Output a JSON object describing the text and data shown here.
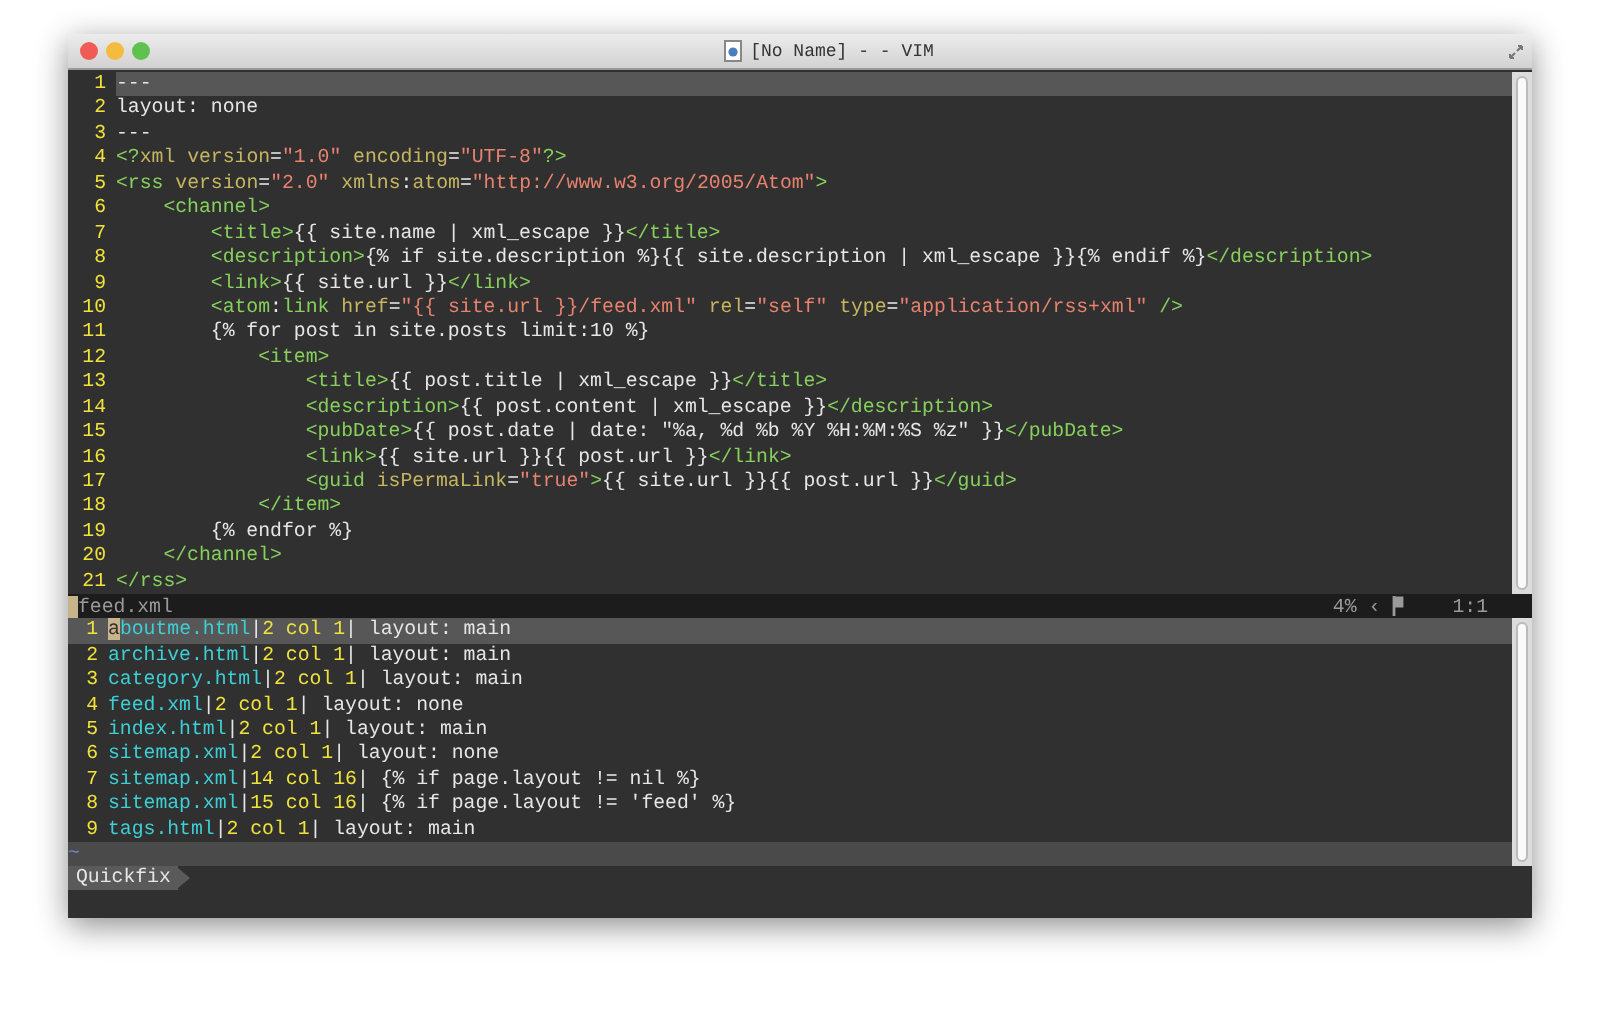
{
  "window": {
    "title": "[No Name] - - VIM"
  },
  "editor": {
    "lines": [
      {
        "number": "1",
        "current": true,
        "tokens": [
          {
            "kind": "text",
            "text": "---"
          }
        ]
      },
      {
        "number": "2",
        "current": false,
        "tokens": [
          {
            "kind": "text",
            "text": "layout: none"
          }
        ]
      },
      {
        "number": "3",
        "current": false,
        "tokens": [
          {
            "kind": "text",
            "text": "---"
          }
        ]
      },
      {
        "number": "4",
        "current": false,
        "tokens": [
          {
            "kind": "tag",
            "text": "<?"
          },
          {
            "kind": "attr",
            "text": "xml version"
          },
          {
            "kind": "text",
            "text": "="
          },
          {
            "kind": "string",
            "text": "\"1.0\""
          },
          {
            "kind": "attr",
            "text": " encoding"
          },
          {
            "kind": "text",
            "text": "="
          },
          {
            "kind": "string",
            "text": "\"UTF-8\""
          },
          {
            "kind": "tag",
            "text": "?>"
          }
        ]
      },
      {
        "number": "5",
        "current": false,
        "tokens": [
          {
            "kind": "tag",
            "text": "<rss"
          },
          {
            "kind": "attr",
            "text": " version"
          },
          {
            "kind": "text",
            "text": "="
          },
          {
            "kind": "string",
            "text": "\"2.0\""
          },
          {
            "kind": "attr",
            "text": " xmlns"
          },
          {
            "kind": "text",
            "text": ":"
          },
          {
            "kind": "attr",
            "text": "atom"
          },
          {
            "kind": "text",
            "text": "="
          },
          {
            "kind": "string",
            "text": "\"http://www.w3.org/2005/Atom\""
          },
          {
            "kind": "tag",
            "text": ">"
          }
        ]
      },
      {
        "number": "6",
        "current": false,
        "tokens": [
          {
            "kind": "tag",
            "text": "    <channel>"
          }
        ]
      },
      {
        "number": "7",
        "current": false,
        "tokens": [
          {
            "kind": "tag",
            "text": "        <title>"
          },
          {
            "kind": "text",
            "text": "{{ site.name | xml_escape }}"
          },
          {
            "kind": "tag",
            "text": "</title>"
          }
        ]
      },
      {
        "number": "8",
        "current": false,
        "tokens": [
          {
            "kind": "tag",
            "text": "        <description>"
          },
          {
            "kind": "text",
            "text": "{% if site.description %}{{ site.description | xml_escape }}{% endif %}"
          },
          {
            "kind": "tag",
            "text": "</description>"
          }
        ]
      },
      {
        "number": "9",
        "current": false,
        "tokens": [
          {
            "kind": "tag",
            "text": "        <link>"
          },
          {
            "kind": "text",
            "text": "{{ site.url }}"
          },
          {
            "kind": "tag",
            "text": "</link>"
          }
        ]
      },
      {
        "number": "10",
        "current": false,
        "tokens": [
          {
            "kind": "tag",
            "text": "        <atom"
          },
          {
            "kind": "text",
            "text": ":"
          },
          {
            "kind": "tag",
            "text": "link"
          },
          {
            "kind": "attr",
            "text": " href"
          },
          {
            "kind": "text",
            "text": "="
          },
          {
            "kind": "string",
            "text": "\"{{ site.url }}/feed.xml\""
          },
          {
            "kind": "attr",
            "text": " rel"
          },
          {
            "kind": "text",
            "text": "="
          },
          {
            "kind": "string",
            "text": "\"self\""
          },
          {
            "kind": "attr",
            "text": " type"
          },
          {
            "kind": "text",
            "text": "="
          },
          {
            "kind": "string",
            "text": "\"application/rss+xml\""
          },
          {
            "kind": "tag",
            "text": " />"
          }
        ]
      },
      {
        "number": "11",
        "current": false,
        "tokens": [
          {
            "kind": "text",
            "text": "        {% for post in site.posts limit:10 %}"
          }
        ]
      },
      {
        "number": "12",
        "current": false,
        "tokens": [
          {
            "kind": "tag",
            "text": "            <item>"
          }
        ]
      },
      {
        "number": "13",
        "current": false,
        "tokens": [
          {
            "kind": "tag",
            "text": "                <title>"
          },
          {
            "kind": "text",
            "text": "{{ post.title | xml_escape }}"
          },
          {
            "kind": "tag",
            "text": "</title>"
          }
        ]
      },
      {
        "number": "14",
        "current": false,
        "tokens": [
          {
            "kind": "tag",
            "text": "                <description>"
          },
          {
            "kind": "text",
            "text": "{{ post.content | xml_escape }}"
          },
          {
            "kind": "tag",
            "text": "</description>"
          }
        ]
      },
      {
        "number": "15",
        "current": false,
        "tokens": [
          {
            "kind": "tag",
            "text": "                <pubDate>"
          },
          {
            "kind": "text",
            "text": "{{ post.date | date: \"%a, %d %b %Y %H:%M:%S %z\" }}"
          },
          {
            "kind": "tag",
            "text": "</pubDate>"
          }
        ]
      },
      {
        "number": "16",
        "current": false,
        "tokens": [
          {
            "kind": "tag",
            "text": "                <link>"
          },
          {
            "kind": "text",
            "text": "{{ site.url }}{{ post.url }}"
          },
          {
            "kind": "tag",
            "text": "</link>"
          }
        ]
      },
      {
        "number": "17",
        "current": false,
        "tokens": [
          {
            "kind": "tag",
            "text": "                <guid"
          },
          {
            "kind": "attr",
            "text": " isPermaLink"
          },
          {
            "kind": "text",
            "text": "="
          },
          {
            "kind": "string",
            "text": "\"true\""
          },
          {
            "kind": "tag",
            "text": ">"
          },
          {
            "kind": "text",
            "text": "{{ site.url }}{{ post.url }}"
          },
          {
            "kind": "tag",
            "text": "</guid>"
          }
        ]
      },
      {
        "number": "18",
        "current": false,
        "tokens": [
          {
            "kind": "tag",
            "text": "            </item>"
          }
        ]
      },
      {
        "number": "19",
        "current": false,
        "tokens": [
          {
            "kind": "text",
            "text": "        {% endfor %}"
          }
        ]
      },
      {
        "number": "20",
        "current": false,
        "tokens": [
          {
            "kind": "tag",
            "text": "    </channel>"
          }
        ]
      },
      {
        "number": "21",
        "current": false,
        "tokens": [
          {
            "kind": "tag",
            "text": "</rss>"
          }
        ]
      }
    ]
  },
  "status_line": {
    "file": "feed.xml",
    "percent": "4%",
    "separator": "‹",
    "position": "1:1"
  },
  "quickfix": {
    "lines": [
      {
        "number": "1",
        "current": true,
        "tokens": [
          {
            "kind": "cursor",
            "text": "a"
          },
          {
            "kind": "file",
            "text": "boutme.html"
          },
          {
            "kind": "text",
            "text": "|"
          },
          {
            "kind": "pos",
            "text": "2 col 1"
          },
          {
            "kind": "text",
            "text": "| layout: main"
          }
        ]
      },
      {
        "number": "2",
        "current": false,
        "tokens": [
          {
            "kind": "file",
            "text": "archive.html"
          },
          {
            "kind": "text",
            "text": "|"
          },
          {
            "kind": "pos",
            "text": "2 col 1"
          },
          {
            "kind": "text",
            "text": "| layout: main"
          }
        ]
      },
      {
        "number": "3",
        "current": false,
        "tokens": [
          {
            "kind": "file",
            "text": "category.html"
          },
          {
            "kind": "text",
            "text": "|"
          },
          {
            "kind": "pos",
            "text": "2 col 1"
          },
          {
            "kind": "text",
            "text": "| layout: main"
          }
        ]
      },
      {
        "number": "4",
        "current": false,
        "tokens": [
          {
            "kind": "file",
            "text": "feed.xml"
          },
          {
            "kind": "text",
            "text": "|"
          },
          {
            "kind": "pos",
            "text": "2 col 1"
          },
          {
            "kind": "text",
            "text": "| layout: none"
          }
        ]
      },
      {
        "number": "5",
        "current": false,
        "tokens": [
          {
            "kind": "file",
            "text": "index.html"
          },
          {
            "kind": "text",
            "text": "|"
          },
          {
            "kind": "pos",
            "text": "2 col 1"
          },
          {
            "kind": "text",
            "text": "| layout: main"
          }
        ]
      },
      {
        "number": "6",
        "current": false,
        "tokens": [
          {
            "kind": "file",
            "text": "sitemap.xml"
          },
          {
            "kind": "text",
            "text": "|"
          },
          {
            "kind": "pos",
            "text": "2 col 1"
          },
          {
            "kind": "text",
            "text": "| layout: none"
          }
        ]
      },
      {
        "number": "7",
        "current": false,
        "tokens": [
          {
            "kind": "file",
            "text": "sitemap.xml"
          },
          {
            "kind": "text",
            "text": "|"
          },
          {
            "kind": "pos",
            "text": "14 col 16"
          },
          {
            "kind": "text",
            "text": "| {% if page.layout != nil %}"
          }
        ]
      },
      {
        "number": "8",
        "current": false,
        "tokens": [
          {
            "kind": "file",
            "text": "sitemap.xml"
          },
          {
            "kind": "text",
            "text": "|"
          },
          {
            "kind": "pos",
            "text": "15 col 16"
          },
          {
            "kind": "text",
            "text": "| {% if page.layout != 'feed' %}"
          }
        ]
      },
      {
        "number": "9",
        "current": false,
        "tokens": [
          {
            "kind": "file",
            "text": "tags.html"
          },
          {
            "kind": "text",
            "text": "|"
          },
          {
            "kind": "pos",
            "text": "2 col 1"
          },
          {
            "kind": "text",
            "text": "| layout: main"
          }
        ]
      }
    ],
    "filler": "~",
    "mode_label": "Quickfix"
  }
}
